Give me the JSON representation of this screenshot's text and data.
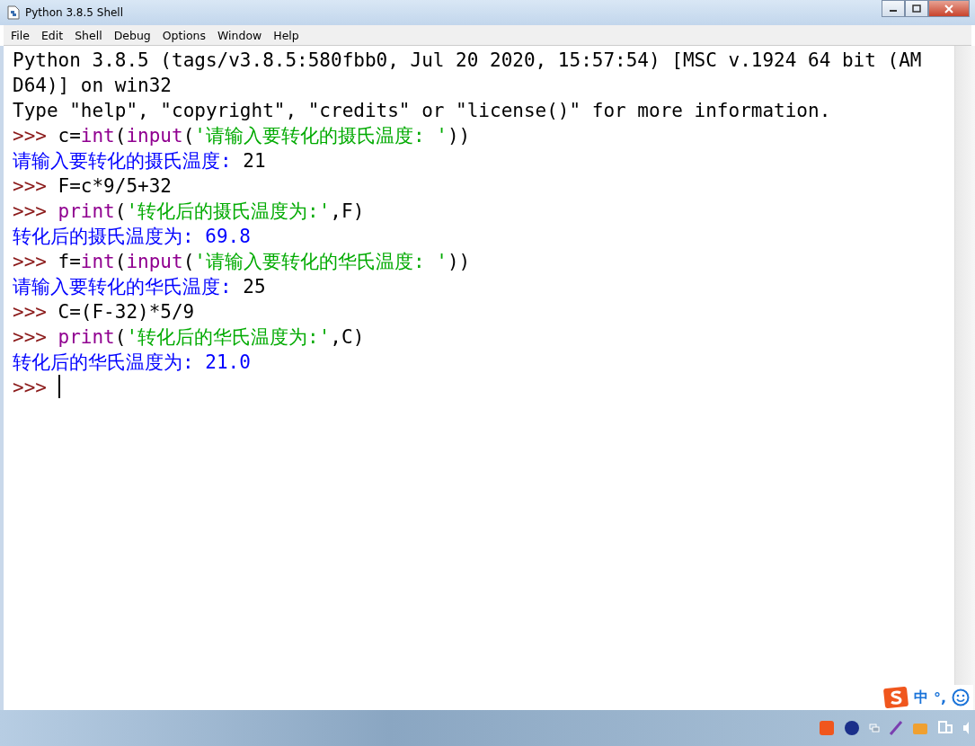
{
  "window": {
    "title": "Python 3.8.5 Shell"
  },
  "menu": [
    "File",
    "Edit",
    "Shell",
    "Debug",
    "Options",
    "Window",
    "Help"
  ],
  "shell_lines": [
    [
      {
        "kind": "output",
        "text": "Python 3.8.5 (tags/v3.8.5:580fbb0, Jul 20 2020, 15:57:54) [MSC v.1924 64 bit (AM"
      }
    ],
    [
      {
        "kind": "output",
        "text": "D64)] on win32"
      }
    ],
    [
      {
        "kind": "output",
        "text": "Type \"help\", \"copyright\", \"credits\" or \"license()\" for more information."
      }
    ],
    [
      {
        "kind": "prompt",
        "text": ">>>"
      },
      {
        "kind": "code",
        "text": "c="
      },
      {
        "kind": "builtin",
        "text": "int"
      },
      {
        "kind": "code",
        "text": "("
      },
      {
        "kind": "builtin",
        "text": "input"
      },
      {
        "kind": "code",
        "text": "("
      },
      {
        "kind": "string",
        "text": "'请输入要转化的摄氏温度: '"
      },
      {
        "kind": "code",
        "text": "))"
      }
    ],
    [
      {
        "kind": "stdout",
        "text": "请输入要转化的摄氏温度: "
      },
      {
        "kind": "code",
        "text": "21"
      }
    ],
    [
      {
        "kind": "prompt",
        "text": ">>>"
      },
      {
        "kind": "code",
        "text": "F=c*9/5+32"
      }
    ],
    [
      {
        "kind": "prompt",
        "text": ">>>"
      },
      {
        "kind": "builtin",
        "text": "print"
      },
      {
        "kind": "code",
        "text": "("
      },
      {
        "kind": "string",
        "text": "'转化后的摄氏温度为:'"
      },
      {
        "kind": "code",
        "text": ",F)"
      }
    ],
    [
      {
        "kind": "stdout",
        "text": "转化后的摄氏温度为: 69.8"
      }
    ],
    [
      {
        "kind": "prompt",
        "text": ">>>"
      },
      {
        "kind": "code",
        "text": "f="
      },
      {
        "kind": "builtin",
        "text": "int"
      },
      {
        "kind": "code",
        "text": "("
      },
      {
        "kind": "builtin",
        "text": "input"
      },
      {
        "kind": "code",
        "text": "("
      },
      {
        "kind": "string",
        "text": "'请输入要转化的华氏温度: '"
      },
      {
        "kind": "code",
        "text": "))"
      }
    ],
    [
      {
        "kind": "stdout",
        "text": "请输入要转化的华氏温度: "
      },
      {
        "kind": "code",
        "text": "25"
      }
    ],
    [
      {
        "kind": "prompt",
        "text": ">>>"
      },
      {
        "kind": "code",
        "text": "C=(F-32)*5/9"
      }
    ],
    [
      {
        "kind": "prompt",
        "text": ">>>"
      },
      {
        "kind": "builtin",
        "text": "print"
      },
      {
        "kind": "code",
        "text": "("
      },
      {
        "kind": "string",
        "text": "'转化后的华氏温度为:'"
      },
      {
        "kind": "code",
        "text": ",C)"
      }
    ],
    [
      {
        "kind": "stdout",
        "text": "转化后的华氏温度为: 21.0"
      }
    ],
    [
      {
        "kind": "prompt",
        "text": ">>>"
      },
      {
        "kind": "cursor"
      }
    ]
  ],
  "ime_bar": {
    "mode": "中",
    "punctuation": "°,"
  }
}
